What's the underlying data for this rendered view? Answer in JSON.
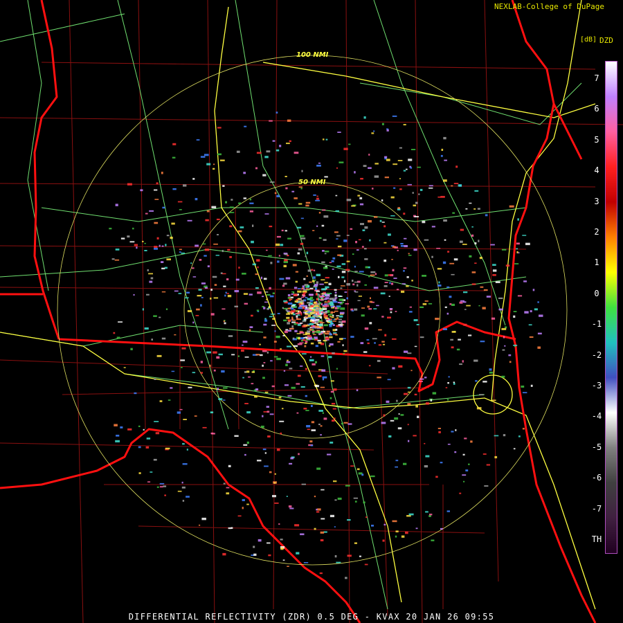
{
  "header": {
    "credit": "NEXLAB-College of DuPage",
    "logo_icon": "nexlab-logo-icon"
  },
  "legend": {
    "unit": "[dB]",
    "product": "DZD",
    "ticks": [
      "7",
      "6",
      "5",
      "4",
      "3",
      "2",
      "1",
      "0",
      "-1",
      "-2",
      "-3",
      "-4",
      "-5",
      "-6",
      "-7",
      "TH"
    ],
    "gradient_colors": [
      "#ffffff",
      "#c080ff",
      "#ff60a0",
      "#ff2020",
      "#c00000",
      "#ff8000",
      "#ffff00",
      "#40e040",
      "#20c0c0",
      "#4050c0",
      "#ffffff",
      "#808080",
      "#404040",
      "#402040",
      "#200020"
    ]
  },
  "map": {
    "ring_labels": [
      "100 NMI",
      "50 NMI"
    ],
    "colors": {
      "state_border": "#ff1010",
      "county_line": "#a01010",
      "highway": "#ffff40",
      "road": "#80ff80",
      "range_ring": "#e0e060"
    }
  },
  "footer": {
    "caption": "DIFFERENTIAL REFLECTIVITY (ZDR) 0.5 DEG - KVAX 20 JAN 26 09:55"
  }
}
